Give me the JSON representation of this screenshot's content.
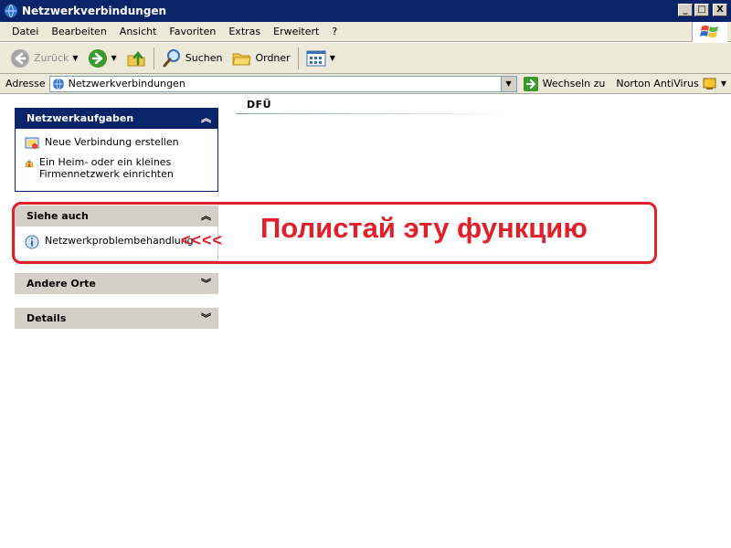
{
  "window": {
    "title": "Netzwerkverbindungen",
    "btn_min": "_",
    "btn_max": "□",
    "btn_close": "X"
  },
  "menu": [
    "Datei",
    "Bearbeiten",
    "Ansicht",
    "Favoriten",
    "Extras",
    "Erweitert",
    "?"
  ],
  "toolbar": {
    "back_label": "Zurück",
    "search_label": "Suchen",
    "folders_label": "Ordner"
  },
  "address": {
    "label": "Adresse",
    "value": "Netzwerkverbindungen",
    "goto_label": "Wechseln zu",
    "norton_label": "Norton AntiVirus"
  },
  "taskpane": {
    "network_tasks": {
      "title": "Netzwerkaufgaben",
      "items": [
        "Neue Verbindung erstellen",
        "Ein Heim- oder ein kleines Firmennetzwerk einrichten"
      ]
    },
    "see_also": {
      "title": "Siehe auch",
      "items": [
        "Netzwerkproblembehandlung"
      ]
    },
    "other_places": {
      "title": "Andere Orte"
    },
    "details": {
      "title": "Details"
    }
  },
  "content": {
    "group_title": "DFÜ"
  },
  "annotation": {
    "text": "Полистай эту функцию",
    "arrows": "<<<<"
  },
  "colors": {
    "title_bar": "#0a246a",
    "annotation": "#e0202a"
  }
}
